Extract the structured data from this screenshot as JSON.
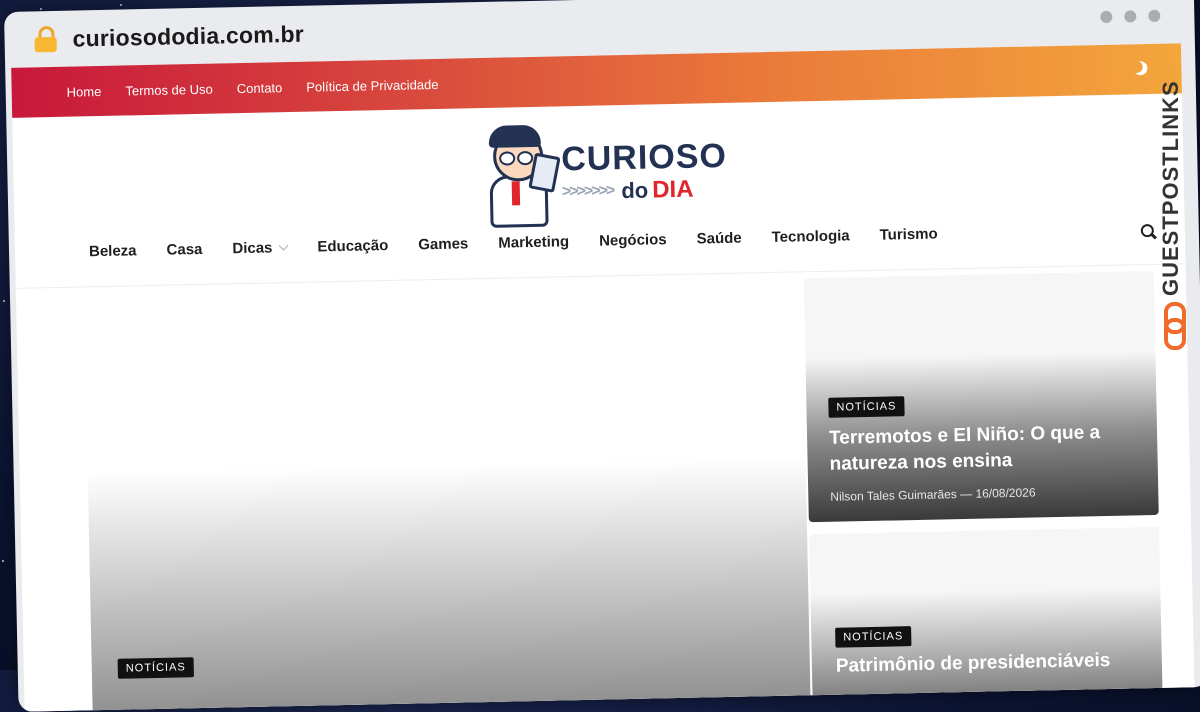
{
  "browser": {
    "url": "curiosododia.com.br"
  },
  "topbar": {
    "links": [
      "Home",
      "Termos de Uso",
      "Contato",
      "Política de Privacidade"
    ],
    "icon": "moon-icon"
  },
  "logo": {
    "top": "CURIOSO",
    "do": "do",
    "dia": "DIA",
    "arrows": ">>>>>>>"
  },
  "nav": {
    "items": [
      "Beleza",
      "Casa",
      "Dicas",
      "Educação",
      "Games",
      "Marketing",
      "Negócios",
      "Saúde",
      "Tecnologia",
      "Turismo"
    ],
    "dropdown_index": 2,
    "search_icon": "search-icon"
  },
  "featured": [
    {
      "tag": "NOTÍCIAS",
      "title": "Terremotos e El Niño: O que a natureza nos ensina",
      "author": "Nilson Tales Guimarães",
      "date": "16/08/2026"
    },
    {
      "tag": "NOTÍCIAS",
      "title": "Patrimônio de presidenciáveis"
    }
  ],
  "hero": {
    "tag": "NOTÍCIAS"
  },
  "watermark": {
    "text": "GUESTPOSTLINKS"
  },
  "colors": {
    "accent_start": "#c8183b",
    "accent_end": "#f3a63c",
    "brand": "#233152",
    "brand_red": "#e0262d"
  }
}
